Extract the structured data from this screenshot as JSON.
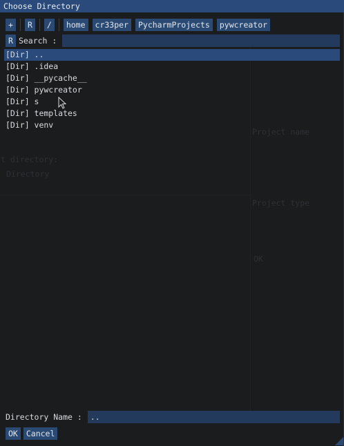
{
  "title": "Choose Directory",
  "toolbar": {
    "new_folder_label": "+",
    "reset_label": "R",
    "root_label": "/",
    "path_segments": [
      "home",
      "cr33per",
      "PycharmProjects",
      "pywcreator"
    ]
  },
  "search": {
    "reset_label": "R",
    "label": "Search :",
    "value": ""
  },
  "entries": [
    {
      "label": "[Dir] ..",
      "selected": true
    },
    {
      "label": "[Dir] .idea",
      "selected": false
    },
    {
      "label": "[Dir] __pycache__",
      "selected": false
    },
    {
      "label": "[Dir] pywcreator",
      "selected": false
    },
    {
      "label": "[Dir] s",
      "selected": false
    },
    {
      "label": "[Dir] templates",
      "selected": false
    },
    {
      "label": "[Dir] venv",
      "selected": false
    }
  ],
  "background_text": {
    "project_name": "Project name",
    "directory_label": "t directory:",
    "directory_value": "Directory",
    "project_type": "Project type",
    "ok_ghost": "OK"
  },
  "directory_name": {
    "label": "Directory Name :",
    "value": ".."
  },
  "actions": {
    "ok_label": "OK",
    "cancel_label": "Cancel"
  },
  "colors": {
    "title_bar": "#294a7a",
    "button": "#2b4a73",
    "input": "#233a5c",
    "window_bg": "#1b1c1e",
    "text": "#d8dbe0"
  }
}
